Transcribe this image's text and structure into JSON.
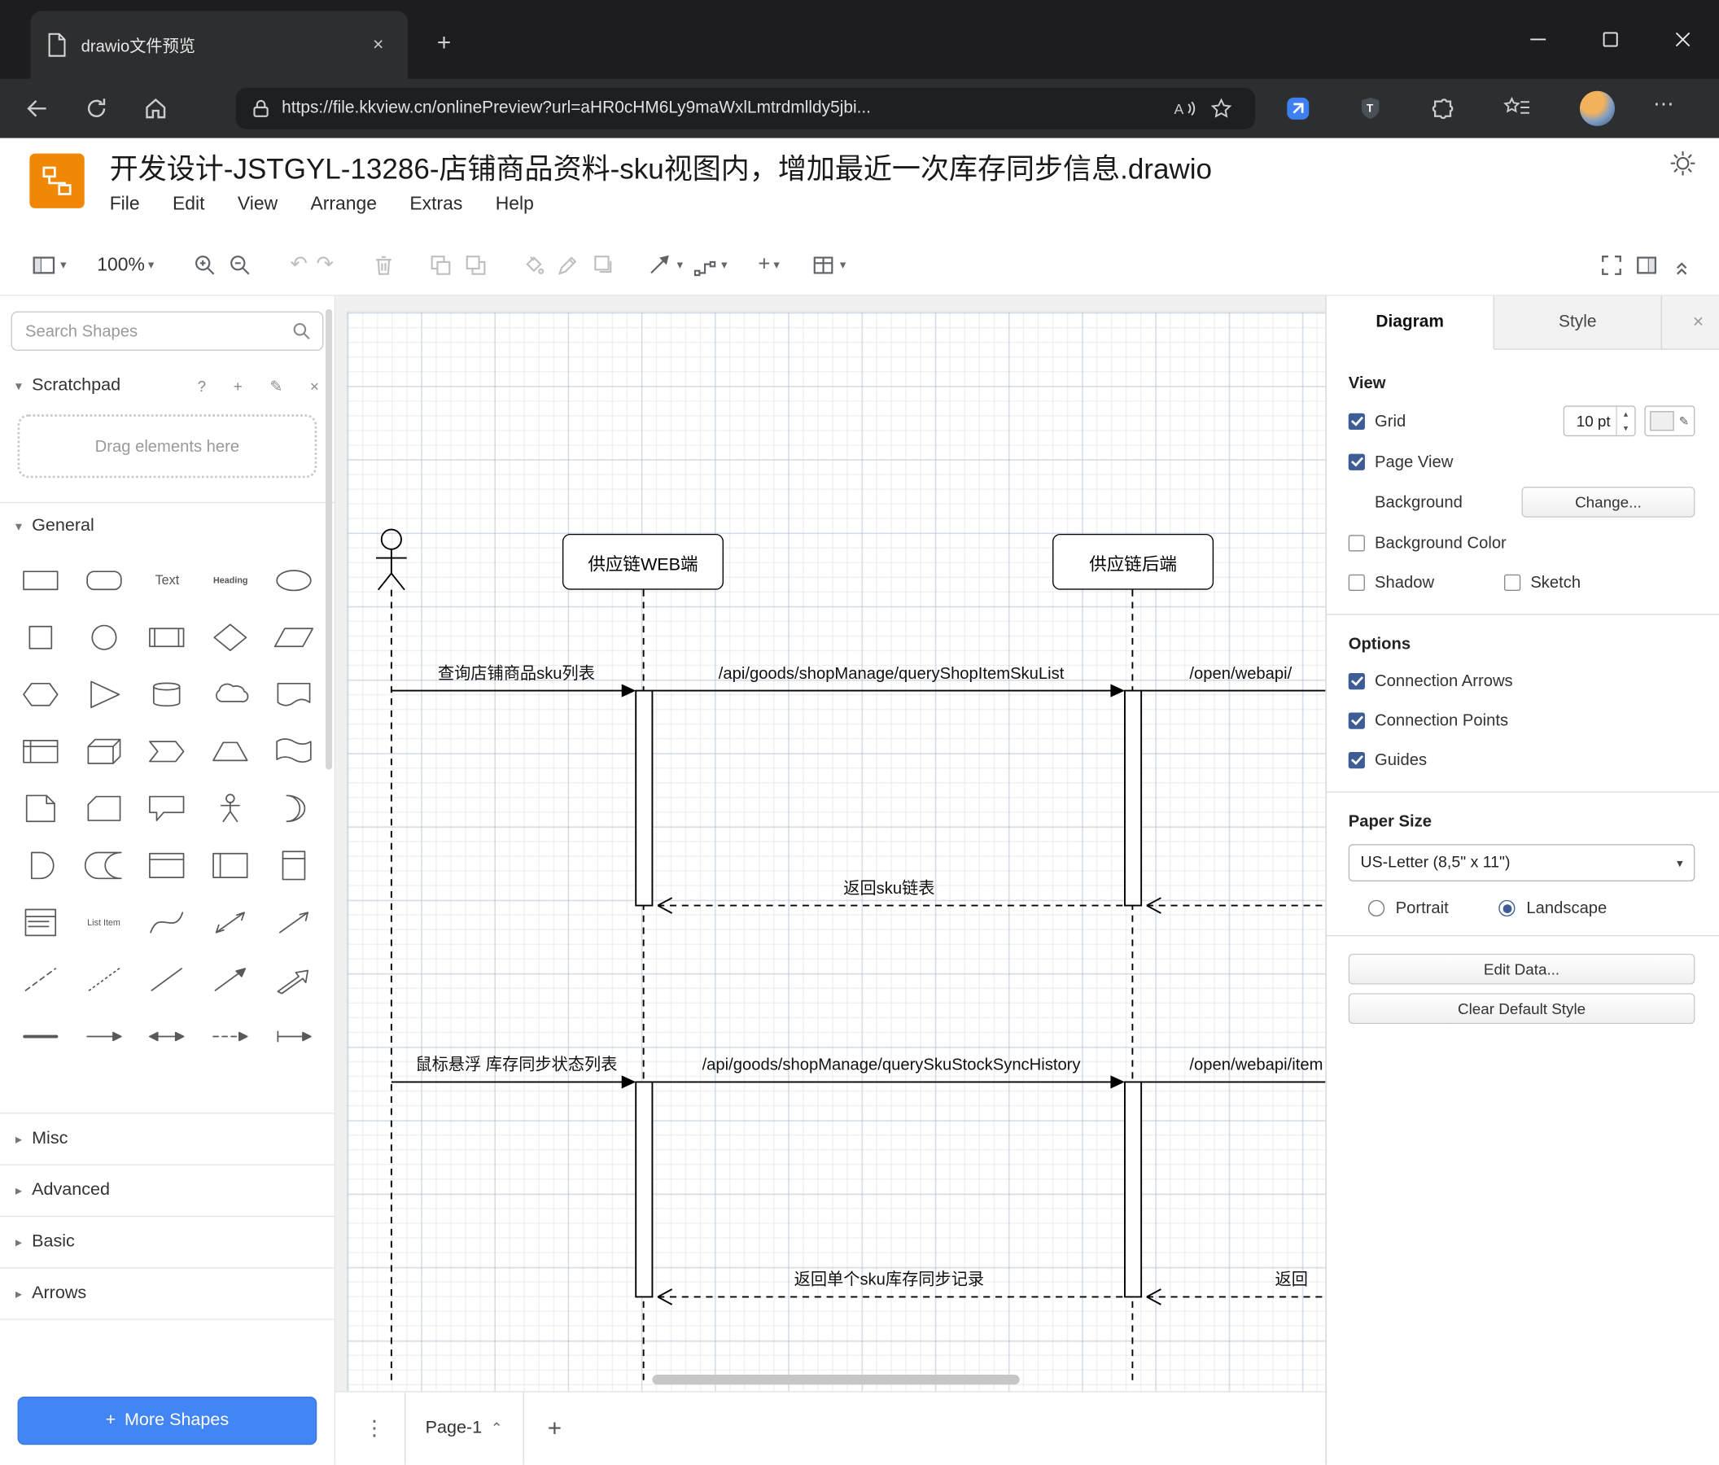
{
  "browser": {
    "tab_title": "drawio文件预览",
    "url": "https://file.kkview.cn/onlinePreview?url=aHR0cHM6Ly9maWxlLmtrdmlldy5jbi..."
  },
  "icons": {
    "caret_down": "▾",
    "caret_right": "▸",
    "caret_up": "⌃",
    "undo": "↶",
    "redo": "↷",
    "plus": "+",
    "overflow_dots": "⋯",
    "kebab_dots": "⋮",
    "question": "?",
    "pencil": "✎",
    "close": "×"
  },
  "app": {
    "title": "开发设计-JSTGYL-13286-店铺商品资料-sku视图内，增加最近一次库存同步信息.drawio",
    "menus": [
      "File",
      "Edit",
      "View",
      "Arrange",
      "Extras",
      "Help"
    ],
    "toolbar": {
      "zoom_level": "100%"
    }
  },
  "sidebar": {
    "search_placeholder": "Search Shapes",
    "scratchpad_label": "Scratchpad",
    "drag_hint": "Drag elements here",
    "general_label": "General",
    "sections": [
      "Misc",
      "Advanced",
      "Basic",
      "Arrows"
    ],
    "more_shapes_label": "More Shapes",
    "shapes": [
      "rectangle",
      "rounded-rectangle",
      "text",
      "heading",
      "ellipse",
      "square",
      "circle",
      "process",
      "diamond",
      "parallelogram",
      "hexagon",
      "triangle",
      "cylinder",
      "cloud",
      "document",
      "internal-storage",
      "cube",
      "step",
      "trapezoid",
      "tape",
      "note",
      "card",
      "callout",
      "actor",
      "or",
      "and",
      "data-storage",
      "container",
      "horizontal-container",
      "vertical-container",
      "list",
      "list-item",
      "curve",
      "bidirectional-arrow",
      "diagonal-arrow",
      "dashed-line",
      "dotted-line",
      "line",
      "directional-arrow",
      "link",
      "crossbar",
      "simple-arrow",
      "double-arrow",
      "dashed-arrow",
      "labeled-arrow"
    ]
  },
  "canvas": {
    "page_tab_label": "Page-1",
    "diagram": {
      "lifeline1_label": "供应链WEB端",
      "lifeline2_label": "供应链后端",
      "messages": {
        "m1": "查询店铺商品sku列表",
        "m2": "/api/goods/shopManage/queryShopItemSkuList",
        "m3": "/open/webapi/",
        "r1": "返回sku链表",
        "m4": "鼠标悬浮 库存同步状态列表",
        "m5": "/api/goods/shopManage/querySkuStockSyncHistory",
        "m6": "/open/webapi/item",
        "r2": "返回单个sku库存同步记录",
        "r3": "返回"
      }
    }
  },
  "format_panel": {
    "tab_diagram": "Diagram",
    "tab_style": "Style",
    "view": {
      "heading": "View",
      "grid": "Grid",
      "grid_size": "10 pt",
      "page_view": "Page View",
      "background": "Background",
      "change": "Change...",
      "background_color": "Background Color",
      "shadow": "Shadow",
      "sketch": "Sketch"
    },
    "options": {
      "heading": "Options",
      "connection_arrows": "Connection Arrows",
      "connection_points": "Connection Points",
      "guides": "Guides"
    },
    "paper": {
      "heading": "Paper Size",
      "size": "US-Letter (8,5\" x 11\")",
      "portrait": "Portrait",
      "landscape": "Landscape"
    },
    "edit_data": "Edit Data...",
    "clear_default_style": "Clear Default Style",
    "checks": {
      "grid": true,
      "page_view": true,
      "background_color": false,
      "shadow": false,
      "sketch": false,
      "connection_arrows": true,
      "connection_points": true,
      "guides": true
    },
    "orientation": "landscape"
  }
}
